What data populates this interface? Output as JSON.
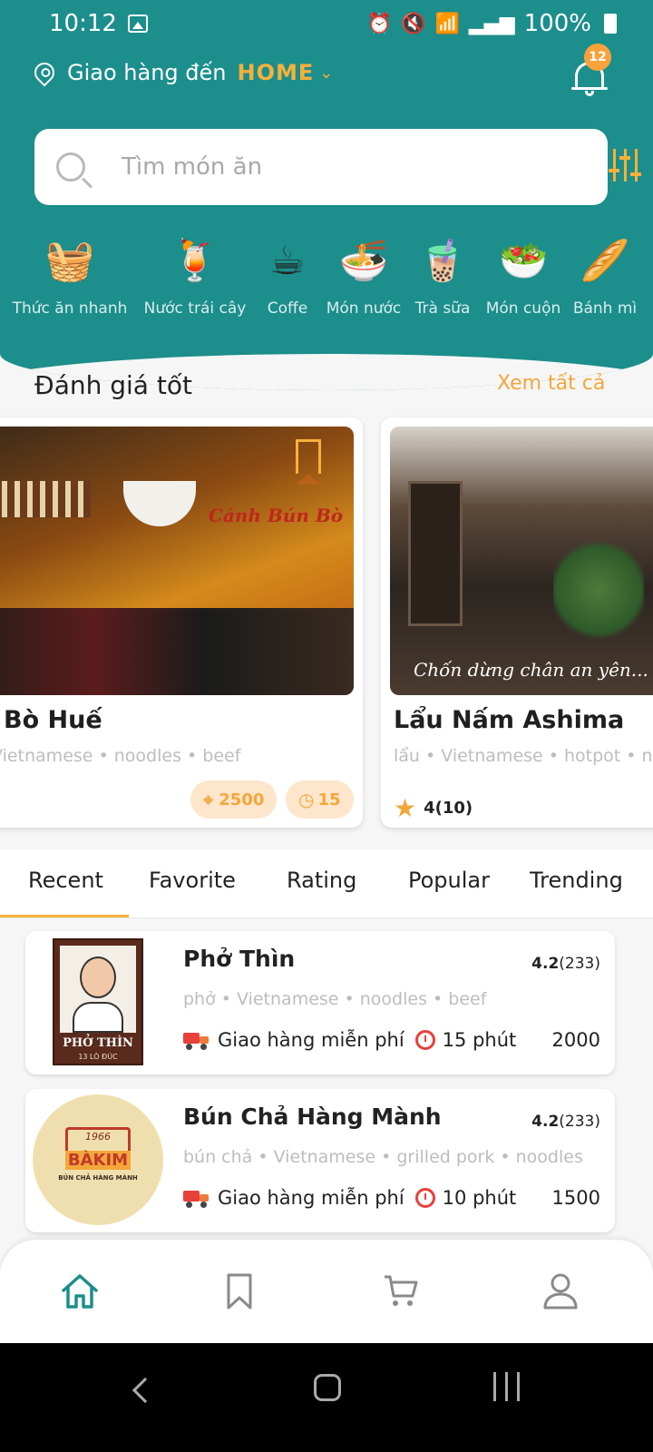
{
  "status_bar": {
    "time": "10:12",
    "battery": "100%"
  },
  "header": {
    "deliver_label": "Giao hàng đến",
    "deliver_place": "HOME",
    "notification_count": "12"
  },
  "search": {
    "placeholder": "Tìm món ăn"
  },
  "categories": [
    {
      "label": "Thức ăn nhanh",
      "icon": "fast-food-icon",
      "glyph": "🧺"
    },
    {
      "label": "Nước trái cây",
      "icon": "juice-icon",
      "glyph": "🍹"
    },
    {
      "label": "Coffe",
      "icon": "coffee-icon",
      "glyph": "☕"
    },
    {
      "label": "Món nước",
      "icon": "noodle-bowl-icon",
      "glyph": "🍜"
    },
    {
      "label": "Trà sữa",
      "icon": "milk-tea-icon",
      "glyph": "🧋"
    },
    {
      "label": "Món cuộn",
      "icon": "roll-icon",
      "glyph": "🥗"
    },
    {
      "label": "Bánh mì",
      "icon": "bread-icon",
      "glyph": "🥖"
    }
  ],
  "top_rated": {
    "title": "Đánh giá tốt",
    "see_all": "Xem tất cả",
    "cards": [
      {
        "name": "Bò Huế",
        "tags": "Vietnamese • noodles • beef",
        "distance": "2500",
        "time": "15",
        "photo_text": "Cánh Bún Bò"
      },
      {
        "name": "Lẩu Nấm Ashima",
        "tags": "lẩu • Vietnamese • hotpot • n",
        "rating": "4",
        "rating_count": "(10)",
        "photo_text": "Chốn dừng chân an yên..."
      }
    ]
  },
  "tabs": [
    "Recent",
    "Favorite",
    "Rating",
    "Popular",
    "Trending"
  ],
  "active_tab": "Recent",
  "restaurants": [
    {
      "name": "Phở Thìn",
      "rating": "4.2",
      "count": "(233)",
      "tags": "phở • Vietnamese • noodles • beef",
      "delivery": "Giao hàng miễn phí",
      "time": "15 phút",
      "price": "2000",
      "logo_text": "PHỞ THÌN",
      "logo_sub": "13 LÒ ĐÚC"
    },
    {
      "name": "Bún Chả Hàng Mành",
      "rating": "4.2",
      "count": "(233)",
      "tags": "bún chả • Vietnamese • grilled pork • noodles",
      "delivery": "Giao hàng miễn phí",
      "time": "10 phút",
      "price": "1500",
      "logo_text": "BÀKIM",
      "logo_year": "1966",
      "logo_sub": "BÚN CHẢ HÀNG MÀNH"
    }
  ],
  "colors": {
    "primary": "#1c8e8c",
    "accent": "#f7b03b",
    "pill_bg": "#fde6cb"
  }
}
